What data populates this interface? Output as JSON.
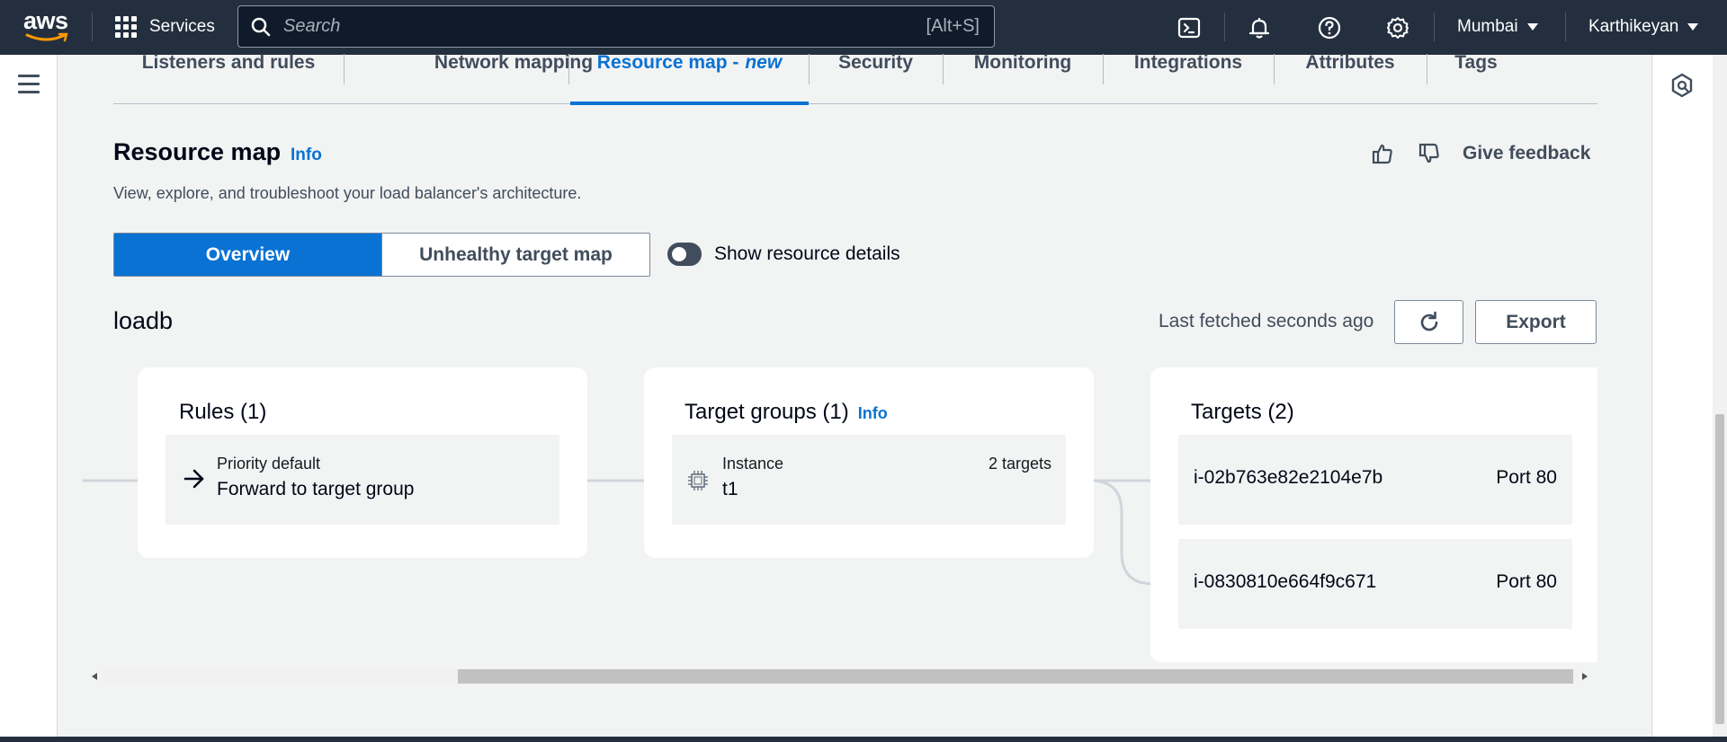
{
  "nav": {
    "logo_text": "aws",
    "services_label": "Services",
    "search_placeholder": "Search",
    "search_shortcut": "[Alt+S]",
    "region": "Mumbai",
    "user": "Karthikeyan"
  },
  "tabs": [
    {
      "label": "Listeners and rules"
    },
    {
      "label": "Network mapping"
    },
    {
      "label": "Resource map - ",
      "suffix": "new"
    },
    {
      "label": "Security"
    },
    {
      "label": "Monitoring"
    },
    {
      "label": "Integrations"
    },
    {
      "label": "Attributes"
    },
    {
      "label": "Tags"
    }
  ],
  "header": {
    "title": "Resource map",
    "info": "Info",
    "description": "View, explore, and troubleshoot your load balancer's architecture.",
    "feedback": "Give feedback"
  },
  "view_toggle": {
    "overview": "Overview",
    "unhealthy": "Unhealthy target map",
    "show_details": "Show resource details"
  },
  "map": {
    "lb_name": "loadb",
    "last_fetched": "Last fetched seconds ago",
    "export": "Export",
    "rules": {
      "title": "Rules (1)",
      "items": [
        {
          "priority": "Priority default",
          "action": "Forward to target group"
        }
      ]
    },
    "target_groups": {
      "title": "Target groups (1)",
      "info": "Info",
      "items": [
        {
          "type": "Instance",
          "name": "t1",
          "count": "2 targets"
        }
      ]
    },
    "targets": {
      "title": "Targets (2)",
      "items": [
        {
          "id": "i-02b763e82e2104e7b",
          "port": "Port 80"
        },
        {
          "id": "i-0830810e664f9c671",
          "port": "Port 80"
        }
      ]
    }
  }
}
